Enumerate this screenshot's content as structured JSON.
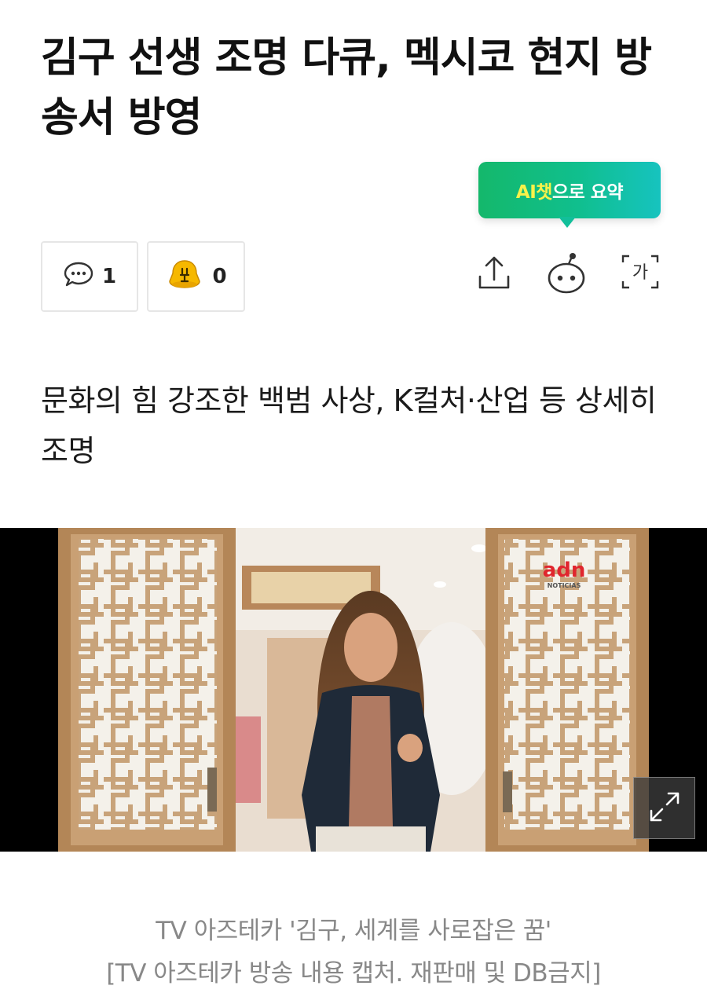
{
  "article": {
    "headline": "김구 선생 조명 다큐, 멕시코 현지 방송서 방영",
    "subheadline": "문화의 힘 강조한 백범 사상, K컬처·산업 등 상세히 조명"
  },
  "ai_summary": {
    "label_highlight": "AI챗",
    "label_rest": "으로 요약"
  },
  "reactions": {
    "comment_count": "1",
    "like_count": "0",
    "comment_icon": "speech-bubble-icon",
    "like_icon": "yellow-face-emoji-icon"
  },
  "toolbar": {
    "share_icon": "share-icon",
    "ai_bot_icon": "chatbot-icon",
    "font_size_icon": "font-size-icon",
    "font_size_glyph": "가"
  },
  "video": {
    "logo_text": "adn",
    "logo_sub": "NOTICIAS"
  },
  "caption": {
    "line1": "TV 아즈테카 '김구, 세계를 사로잡은 꿈'",
    "line2": "[TV 아즈테카 방송 내용 캡처. 재판매 및 DB금지]"
  },
  "colors": {
    "ai_gradient_start": "#14b86b",
    "ai_gradient_end": "#16c3bf",
    "ai_highlight": "#f7f24a",
    "caption_gray": "#888888"
  }
}
